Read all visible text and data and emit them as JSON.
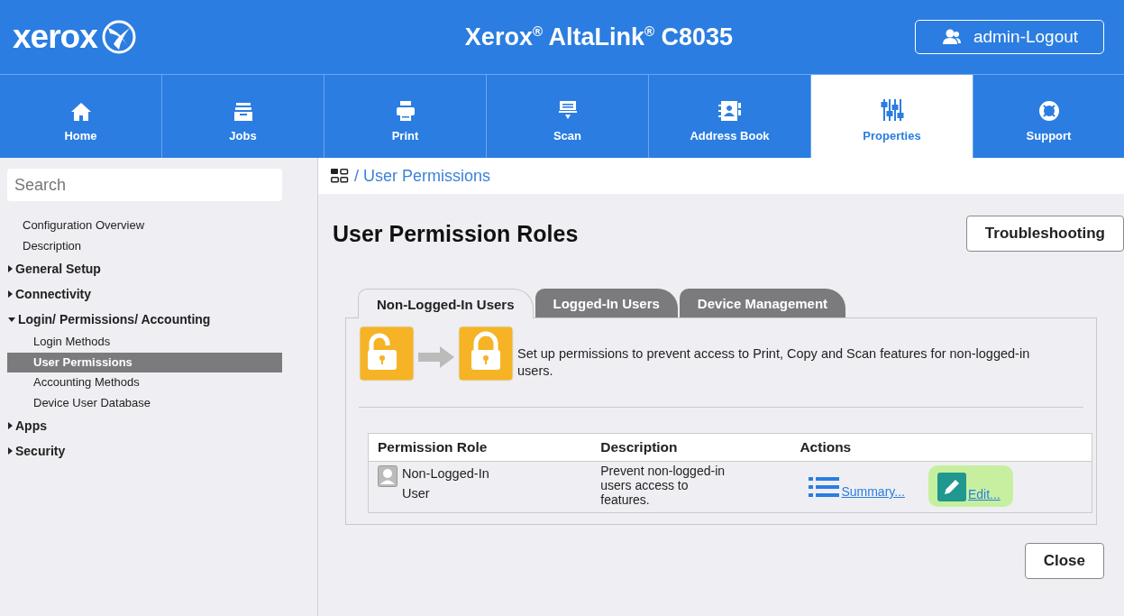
{
  "header": {
    "logo": "xerox",
    "title": "Xerox$^{®}$ AltaLink$^{®}$ C8035",
    "user_button": "admin-Logout"
  },
  "nav": [
    {
      "label": "Home",
      "selected": false
    },
    {
      "label": "Jobs",
      "selected": false
    },
    {
      "label": "Print",
      "selected": false
    },
    {
      "label": "Scan",
      "selected": false
    },
    {
      "label": "Address Book",
      "selected": false
    },
    {
      "label": "Properties",
      "selected": true
    },
    {
      "label": "Support",
      "selected": false
    }
  ],
  "sidebar": {
    "search": {
      "placeholder": "Search"
    },
    "items": [
      {
        "label": "Configuration Overview",
        "selected": false
      },
      {
        "label": "Description",
        "selected": false
      },
      {
        "label": "General Setup",
        "expanded": false,
        "selected": false
      },
      {
        "label": "Connectivity",
        "expanded": false,
        "selected": false
      },
      {
        "label": "Login/ Permissions/ Accounting",
        "expanded": true,
        "selected": false,
        "children": [
          {
            "label": "Login Methods",
            "selected": false
          },
          {
            "label": "User Permissions",
            "selected": true
          },
          {
            "label": "Accounting Methods",
            "selected": false
          },
          {
            "label": "Device User Database",
            "selected": false
          }
        ]
      },
      {
        "label": "Apps",
        "expanded": false,
        "selected": false
      },
      {
        "label": "Security",
        "expanded": false,
        "selected": false
      }
    ]
  },
  "breadcrumb": "/ User Permissions",
  "page_title": "User Permission Roles",
  "troubleshooting_button": "Troubleshooting",
  "tabs": [
    {
      "label": "Non-Logged-In Users",
      "selected": true
    },
    {
      "label": "Logged-In Users",
      "selected": false
    },
    {
      "label": "Device Management",
      "selected": false
    }
  ],
  "info_text": "Set up permissions to prevent access to Print, Copy and Scan features for non-logged-in users.",
  "table": {
    "columns": [
      "Permission Role",
      "Description",
      "Actions"
    ],
    "rows": [
      {
        "role": "Non-Logged-In User",
        "description": "Prevent non-logged-in users access to features.",
        "actions": [
          {
            "kind": "summary",
            "label": "Summary...",
            "highlighted": false
          },
          {
            "kind": "edit",
            "label": "Edit...",
            "highlighted": true
          }
        ]
      }
    ]
  },
  "close_button": "Close"
}
